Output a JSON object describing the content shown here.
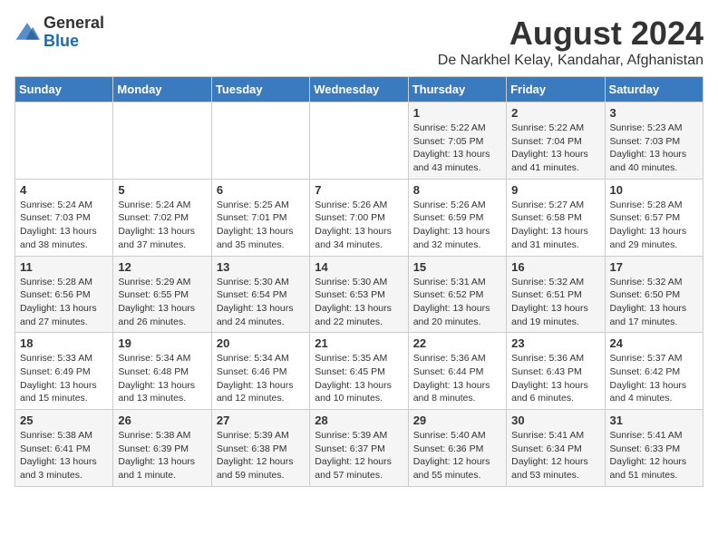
{
  "logo": {
    "general": "General",
    "blue": "Blue"
  },
  "header": {
    "title": "August 2024",
    "subtitle": "De Narkhel Kelay, Kandahar, Afghanistan"
  },
  "weekdays": [
    "Sunday",
    "Monday",
    "Tuesday",
    "Wednesday",
    "Thursday",
    "Friday",
    "Saturday"
  ],
  "weeks": [
    [
      {
        "day": "",
        "info": ""
      },
      {
        "day": "",
        "info": ""
      },
      {
        "day": "",
        "info": ""
      },
      {
        "day": "",
        "info": ""
      },
      {
        "day": "1",
        "info": "Sunrise: 5:22 AM\nSunset: 7:05 PM\nDaylight: 13 hours\nand 43 minutes."
      },
      {
        "day": "2",
        "info": "Sunrise: 5:22 AM\nSunset: 7:04 PM\nDaylight: 13 hours\nand 41 minutes."
      },
      {
        "day": "3",
        "info": "Sunrise: 5:23 AM\nSunset: 7:03 PM\nDaylight: 13 hours\nand 40 minutes."
      }
    ],
    [
      {
        "day": "4",
        "info": "Sunrise: 5:24 AM\nSunset: 7:03 PM\nDaylight: 13 hours\nand 38 minutes."
      },
      {
        "day": "5",
        "info": "Sunrise: 5:24 AM\nSunset: 7:02 PM\nDaylight: 13 hours\nand 37 minutes."
      },
      {
        "day": "6",
        "info": "Sunrise: 5:25 AM\nSunset: 7:01 PM\nDaylight: 13 hours\nand 35 minutes."
      },
      {
        "day": "7",
        "info": "Sunrise: 5:26 AM\nSunset: 7:00 PM\nDaylight: 13 hours\nand 34 minutes."
      },
      {
        "day": "8",
        "info": "Sunrise: 5:26 AM\nSunset: 6:59 PM\nDaylight: 13 hours\nand 32 minutes."
      },
      {
        "day": "9",
        "info": "Sunrise: 5:27 AM\nSunset: 6:58 PM\nDaylight: 13 hours\nand 31 minutes."
      },
      {
        "day": "10",
        "info": "Sunrise: 5:28 AM\nSunset: 6:57 PM\nDaylight: 13 hours\nand 29 minutes."
      }
    ],
    [
      {
        "day": "11",
        "info": "Sunrise: 5:28 AM\nSunset: 6:56 PM\nDaylight: 13 hours\nand 27 minutes."
      },
      {
        "day": "12",
        "info": "Sunrise: 5:29 AM\nSunset: 6:55 PM\nDaylight: 13 hours\nand 26 minutes."
      },
      {
        "day": "13",
        "info": "Sunrise: 5:30 AM\nSunset: 6:54 PM\nDaylight: 13 hours\nand 24 minutes."
      },
      {
        "day": "14",
        "info": "Sunrise: 5:30 AM\nSunset: 6:53 PM\nDaylight: 13 hours\nand 22 minutes."
      },
      {
        "day": "15",
        "info": "Sunrise: 5:31 AM\nSunset: 6:52 PM\nDaylight: 13 hours\nand 20 minutes."
      },
      {
        "day": "16",
        "info": "Sunrise: 5:32 AM\nSunset: 6:51 PM\nDaylight: 13 hours\nand 19 minutes."
      },
      {
        "day": "17",
        "info": "Sunrise: 5:32 AM\nSunset: 6:50 PM\nDaylight: 13 hours\nand 17 minutes."
      }
    ],
    [
      {
        "day": "18",
        "info": "Sunrise: 5:33 AM\nSunset: 6:49 PM\nDaylight: 13 hours\nand 15 minutes."
      },
      {
        "day": "19",
        "info": "Sunrise: 5:34 AM\nSunset: 6:48 PM\nDaylight: 13 hours\nand 13 minutes."
      },
      {
        "day": "20",
        "info": "Sunrise: 5:34 AM\nSunset: 6:46 PM\nDaylight: 13 hours\nand 12 minutes."
      },
      {
        "day": "21",
        "info": "Sunrise: 5:35 AM\nSunset: 6:45 PM\nDaylight: 13 hours\nand 10 minutes."
      },
      {
        "day": "22",
        "info": "Sunrise: 5:36 AM\nSunset: 6:44 PM\nDaylight: 13 hours\nand 8 minutes."
      },
      {
        "day": "23",
        "info": "Sunrise: 5:36 AM\nSunset: 6:43 PM\nDaylight: 13 hours\nand 6 minutes."
      },
      {
        "day": "24",
        "info": "Sunrise: 5:37 AM\nSunset: 6:42 PM\nDaylight: 13 hours\nand 4 minutes."
      }
    ],
    [
      {
        "day": "25",
        "info": "Sunrise: 5:38 AM\nSunset: 6:41 PM\nDaylight: 13 hours\nand 3 minutes."
      },
      {
        "day": "26",
        "info": "Sunrise: 5:38 AM\nSunset: 6:39 PM\nDaylight: 13 hours\nand 1 minute."
      },
      {
        "day": "27",
        "info": "Sunrise: 5:39 AM\nSunset: 6:38 PM\nDaylight: 12 hours\nand 59 minutes."
      },
      {
        "day": "28",
        "info": "Sunrise: 5:39 AM\nSunset: 6:37 PM\nDaylight: 12 hours\nand 57 minutes."
      },
      {
        "day": "29",
        "info": "Sunrise: 5:40 AM\nSunset: 6:36 PM\nDaylight: 12 hours\nand 55 minutes."
      },
      {
        "day": "30",
        "info": "Sunrise: 5:41 AM\nSunset: 6:34 PM\nDaylight: 12 hours\nand 53 minutes."
      },
      {
        "day": "31",
        "info": "Sunrise: 5:41 AM\nSunset: 6:33 PM\nDaylight: 12 hours\nand 51 minutes."
      }
    ]
  ]
}
